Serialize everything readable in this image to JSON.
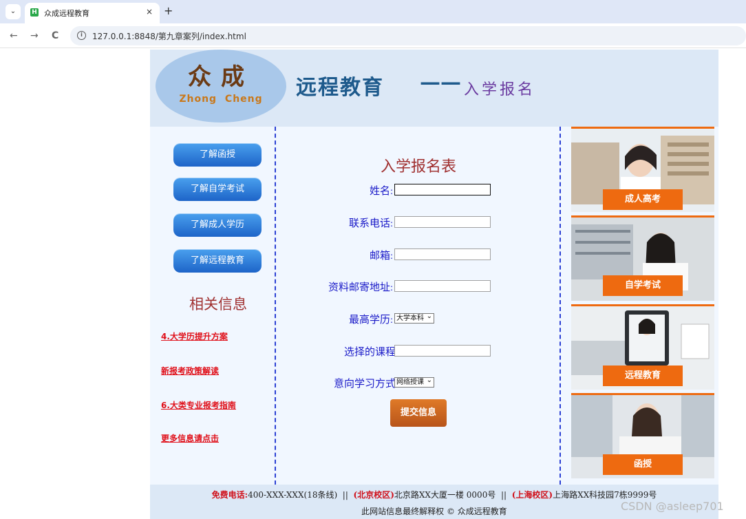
{
  "browser": {
    "tab_title": "众成远程教育",
    "tab_close": "×",
    "new_tab": "+",
    "menu": "⌄",
    "favicon": "H",
    "url": "127.0.0.1:8848/第九章案列/index.html",
    "back": "←",
    "forward": "→",
    "reload": "C",
    "info": "i"
  },
  "banner": {
    "logo_cn": "众成",
    "logo_en": "Zhong Cheng",
    "title": "远程教育",
    "dash": "——",
    "subtitle": "入学报名"
  },
  "nav": {
    "buttons": [
      "了解函授",
      "了解自学考试",
      "了解成人学历",
      "了解远程教育"
    ],
    "info_title": "相关信息",
    "links": [
      "4.大学历提升方案",
      "新报考政策解读",
      "6.大类专业报考指南",
      "更多信息请点击"
    ]
  },
  "form": {
    "title": "入学报名表",
    "fields": [
      {
        "label": "姓名",
        "colon": ":"
      },
      {
        "label": "联系电话",
        "colon": ":"
      },
      {
        "label": "邮箱",
        "colon": ":"
      },
      {
        "label": "资料邮寄地址",
        "colon": ":"
      },
      {
        "label": "最高学历",
        "colon": ":",
        "selected": "大学本科"
      },
      {
        "label": "选择的课程",
        "colon": ""
      },
      {
        "label": "意向学习方式",
        "colon": "",
        "selected": "网络授课"
      }
    ],
    "submit": "提交信息"
  },
  "cards": [
    "成人高考",
    "自学考试",
    "远程教育",
    "函授"
  ],
  "footer": {
    "phone_label": "免费电话:",
    "phone": "400-XXX-XXX(18条线)",
    "sep": "||",
    "beijing_label": "(北京校区)",
    "beijing_addr": "北京路XX大厦一楼 0000号",
    "shanghai_label": "(上海校区)",
    "shanghai_addr": "上海路XX科技园7栋9999号",
    "rights": "此网站信息最终解释权 © 众成远程教育"
  },
  "watermark": "CSDN @asleep701",
  "colors": {
    "accent_orange": "#ee6a10",
    "nav_blue": "#1d64c8",
    "title_red": "#a03030",
    "link_red": "#e0101a",
    "label_blue": "#1a1ac8"
  }
}
